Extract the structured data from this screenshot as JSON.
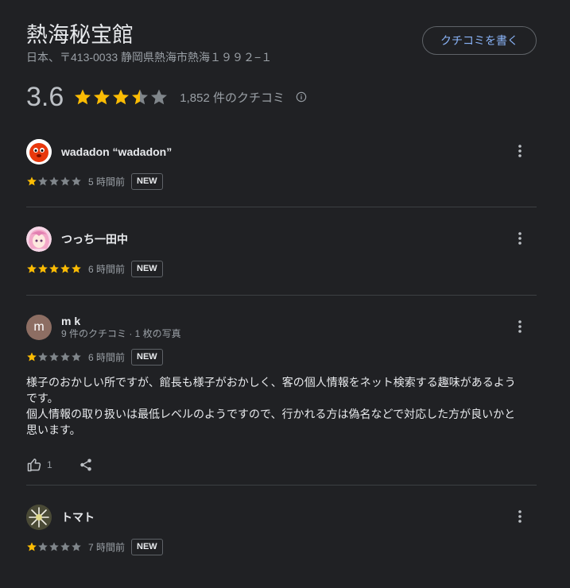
{
  "place": {
    "title": "熱海秘宝館",
    "address": "日本、〒413-0033 静岡県熱海市熱海１９９２−１",
    "write_review_label": "クチコミを書く"
  },
  "summary": {
    "score": "3.6",
    "rating": 3.6,
    "review_count": "1,852 件のクチコミ"
  },
  "colors": {
    "star_filled": "#fbbc04",
    "star_empty": "#80868b",
    "link": "#8ab4f8"
  },
  "reviews": [
    {
      "author": "wadadon “wadadon”",
      "meta": "",
      "stars": 1,
      "time": "5 時間前",
      "badge": "NEW",
      "avatar": "red-character"
    },
    {
      "author": "つっち一田中",
      "meta": "",
      "stars": 5,
      "time": "6 時間前",
      "badge": "NEW",
      "avatar": "anime-girl"
    },
    {
      "author": "m k",
      "meta": "9 件のクチコミ · 1 枚の写真",
      "stars": 1,
      "time": "6 時間前",
      "badge": "NEW",
      "avatar_letter": "m",
      "text_line1": "様子のおかしい所ですが、館長も様子がおかしく、客の個人情報をネット検索する趣味があるよう",
      "text_line2": "です。",
      "text_line3": "個人情報の取り扱いは最低レベルのようですので、行かれる方は偽名などで対応した方が良いかと",
      "text_line4": "思います。",
      "likes": "1"
    },
    {
      "author": "トマト",
      "meta": "",
      "stars": 1,
      "time": "7 時間前",
      "badge": "NEW",
      "avatar": "white-flower"
    }
  ]
}
